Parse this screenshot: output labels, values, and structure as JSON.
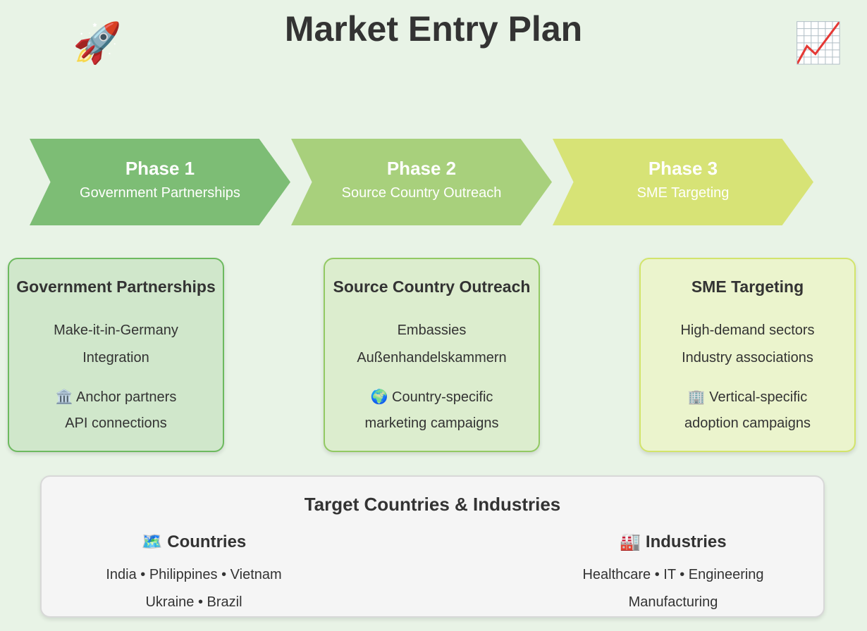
{
  "header": {
    "title": "Market Entry Plan",
    "left_emoji": "🚀",
    "right_emoji": "📈"
  },
  "phases": [
    {
      "label": "Phase 1",
      "subtitle": "Government Partnerships",
      "color": "#7dbd75"
    },
    {
      "label": "Phase 2",
      "subtitle": "Source Country Outreach",
      "color": "#a8d07c"
    },
    {
      "label": "Phase 3",
      "subtitle": "SME Targeting",
      "color": "#d7e376"
    }
  ],
  "cards": [
    {
      "title": "Government Partnerships",
      "lines": [
        "Make-it-in-Germany",
        "Integration",
        "🏛️ Anchor partners",
        "API connections"
      ]
    },
    {
      "title": "Source Country Outreach",
      "lines": [
        "Embassies",
        "Außenhandelskammern",
        "🌍 Country-specific",
        "marketing campaigns"
      ]
    },
    {
      "title": "SME Targeting",
      "lines": [
        "High-demand sectors",
        "Industry associations",
        "🏢 Vertical-specific",
        "adoption campaigns"
      ]
    }
  ],
  "targets": {
    "title": "Target Countries & Industries",
    "countries": {
      "heading": "🗺️ Countries",
      "lines": [
        "India • Philippines • Vietnam",
        "Ukraine • Brazil"
      ]
    },
    "industries": {
      "heading": "🏭 Industries",
      "lines": [
        "Healthcare • IT • Engineering",
        "Manufacturing"
      ]
    }
  }
}
